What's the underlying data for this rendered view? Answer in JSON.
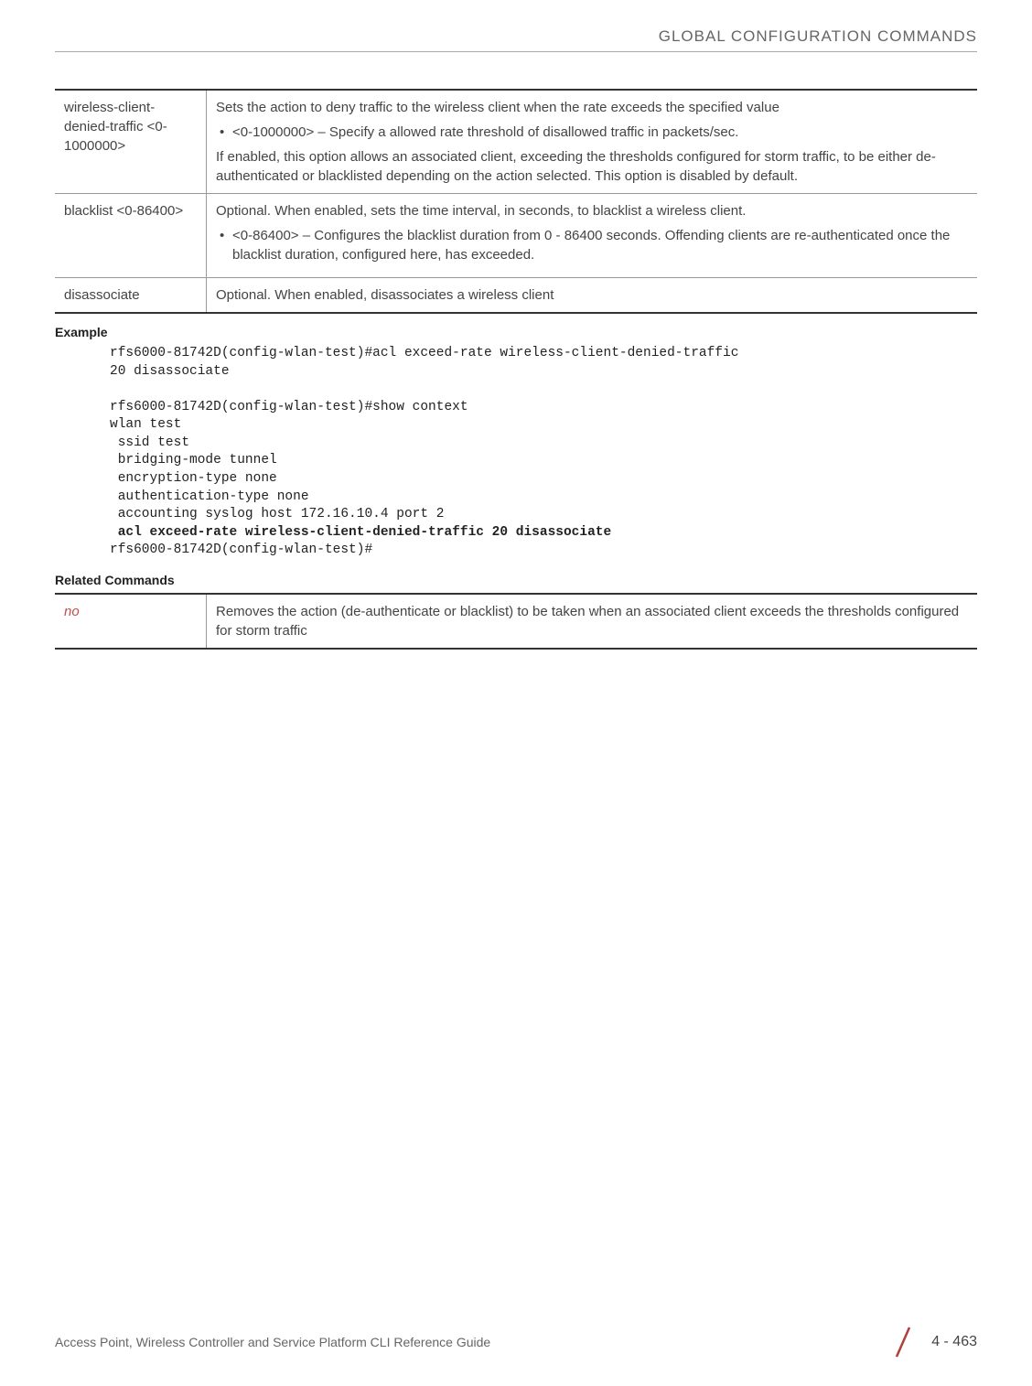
{
  "header": {
    "title": "GLOBAL CONFIGURATION COMMANDS"
  },
  "param_table": {
    "rows": [
      {
        "param": "wireless-client-denied-traffic <0-1000000>",
        "desc_intro": "Sets the action to deny traffic to the wireless client when the rate exceeds the specified value",
        "bullet": "<0-1000000> – Specify a allowed rate threshold of disallowed traffic in packets/sec.",
        "desc_outro": "If enabled, this option allows an associated client, exceeding the thresholds configured for storm traffic, to be either de-authenticated or blacklisted depending on the action selected. This option is disabled by default."
      },
      {
        "param": "blacklist <0-86400>",
        "desc_intro": "Optional. When enabled, sets the time interval, in seconds, to blacklist a wireless client.",
        "bullet": "<0-86400> – Configures the blacklist duration from 0 - 86400 seconds. Offending clients are re-authenticated once the blacklist duration, configured here, has exceeded.",
        "desc_outro": ""
      },
      {
        "param": "disassociate",
        "desc_intro": "Optional. When enabled, disassociates a wireless client",
        "bullet": "",
        "desc_outro": ""
      }
    ]
  },
  "example": {
    "heading": "Example",
    "line1": "rfs6000-81742D(config-wlan-test)#acl exceed-rate wireless-client-denied-traffic",
    "line2": "20 disassociate",
    "line3": "",
    "line4": "rfs6000-81742D(config-wlan-test)#show context",
    "line5": "wlan test",
    "line6": " ssid test",
    "line7": " bridging-mode tunnel",
    "line8": " encryption-type none",
    "line9": " authentication-type none",
    "line10": " accounting syslog host 172.16.10.4 port 2",
    "line11_bold": " acl exceed-rate wireless-client-denied-traffic 20 disassociate",
    "line12": "rfs6000-81742D(config-wlan-test)#"
  },
  "related": {
    "heading": "Related Commands",
    "cmd": "no",
    "desc": "Removes the action (de-authenticate or blacklist) to be taken when an associated client exceeds the thresholds configured for storm traffic"
  },
  "footer": {
    "left": "Access Point, Wireless Controller and Service Platform CLI Reference Guide",
    "page": "4 - 463"
  }
}
